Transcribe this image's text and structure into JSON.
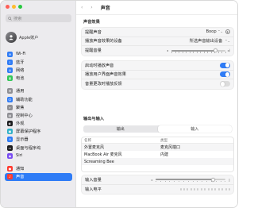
{
  "sidebar": {
    "search_placeholder": "搜索",
    "account_name": "Apple账户",
    "items": [
      {
        "label": "Wi-Fi",
        "icon": "wifi-icon",
        "color": "#2f7cf6",
        "glyph": "≋"
      },
      {
        "label": "蓝牙",
        "icon": "bluetooth-icon",
        "color": "#2f7cf6",
        "glyph": "ᛒ"
      },
      {
        "label": "网络",
        "icon": "network-icon",
        "color": "#2f7cf6",
        "glyph": "◎"
      },
      {
        "label": "电池",
        "icon": "battery-icon",
        "color": "#34c759",
        "glyph": "▮"
      },
      {
        "gap": true
      },
      {
        "label": "通用",
        "icon": "gear-icon",
        "color": "#8e8e93",
        "glyph": "⚙"
      },
      {
        "label": "辅助功能",
        "icon": "accessibility-icon",
        "color": "#2f7cf6",
        "glyph": "☺"
      },
      {
        "label": "聚焦",
        "icon": "spotlight-icon",
        "color": "#8e8e93",
        "glyph": "⌕"
      },
      {
        "label": "控制中心",
        "icon": "control-center-icon",
        "color": "#8e8e93",
        "glyph": "▤"
      },
      {
        "label": "外观",
        "icon": "appearance-icon",
        "color": "#1c1c1e",
        "glyph": "◐"
      },
      {
        "label": "屏幕保护程序",
        "icon": "screensaver-icon",
        "color": "#30b0c7",
        "glyph": "▣"
      },
      {
        "label": "显示器",
        "icon": "display-icon",
        "color": "#2f7cf6",
        "glyph": "☼"
      },
      {
        "label": "桌面与程序坞",
        "icon": "desktop-dock-icon",
        "color": "#1c1c1e",
        "glyph": "▭"
      },
      {
        "label": "Siri",
        "icon": "siri-icon",
        "color": "#7a4df2",
        "glyph": "◉"
      },
      {
        "gap": true
      },
      {
        "label": "通知",
        "icon": "notifications-icon",
        "color": "#ff3b30",
        "glyph": "●"
      },
      {
        "label": "声音",
        "icon": "sound-icon",
        "color": "#ff3b30",
        "glyph": "♪",
        "active": true
      }
    ]
  },
  "header": {
    "title": "声音"
  },
  "effects": {
    "section_title": "声音效果",
    "alert_sound_label": "提醒声音",
    "alert_sound_value": "Boop",
    "play_effects_through_label": "播放声音效果的设备",
    "play_effects_through_value": "所选声音输出设备",
    "alert_volume_label": "提醒音量",
    "alert_volume": 0.82,
    "startup_sound_label": "启动时播放声音",
    "startup_sound_on": true,
    "ui_effects_label": "播放用户界面声音效果",
    "ui_effects_on": true,
    "volume_feedback_label": "音量更改时播放反馈",
    "volume_feedback_on": false
  },
  "io": {
    "section_title": "输出与输入",
    "tabs": [
      "输出",
      "输入"
    ],
    "selected_tab": 1,
    "col_name": "名称",
    "col_type": "类型",
    "devices": [
      {
        "name": "外置麦克风",
        "type": "麦克风端口"
      },
      {
        "name": "MacBook Air 麦克风",
        "type": "内建"
      },
      {
        "name": "Screaming Bee",
        "type": ""
      }
    ],
    "input_volume_label": "输入音量",
    "input_volume": 0.82,
    "input_level_label": "输入电平"
  },
  "colors": {
    "accent": "#2f7cf6"
  }
}
